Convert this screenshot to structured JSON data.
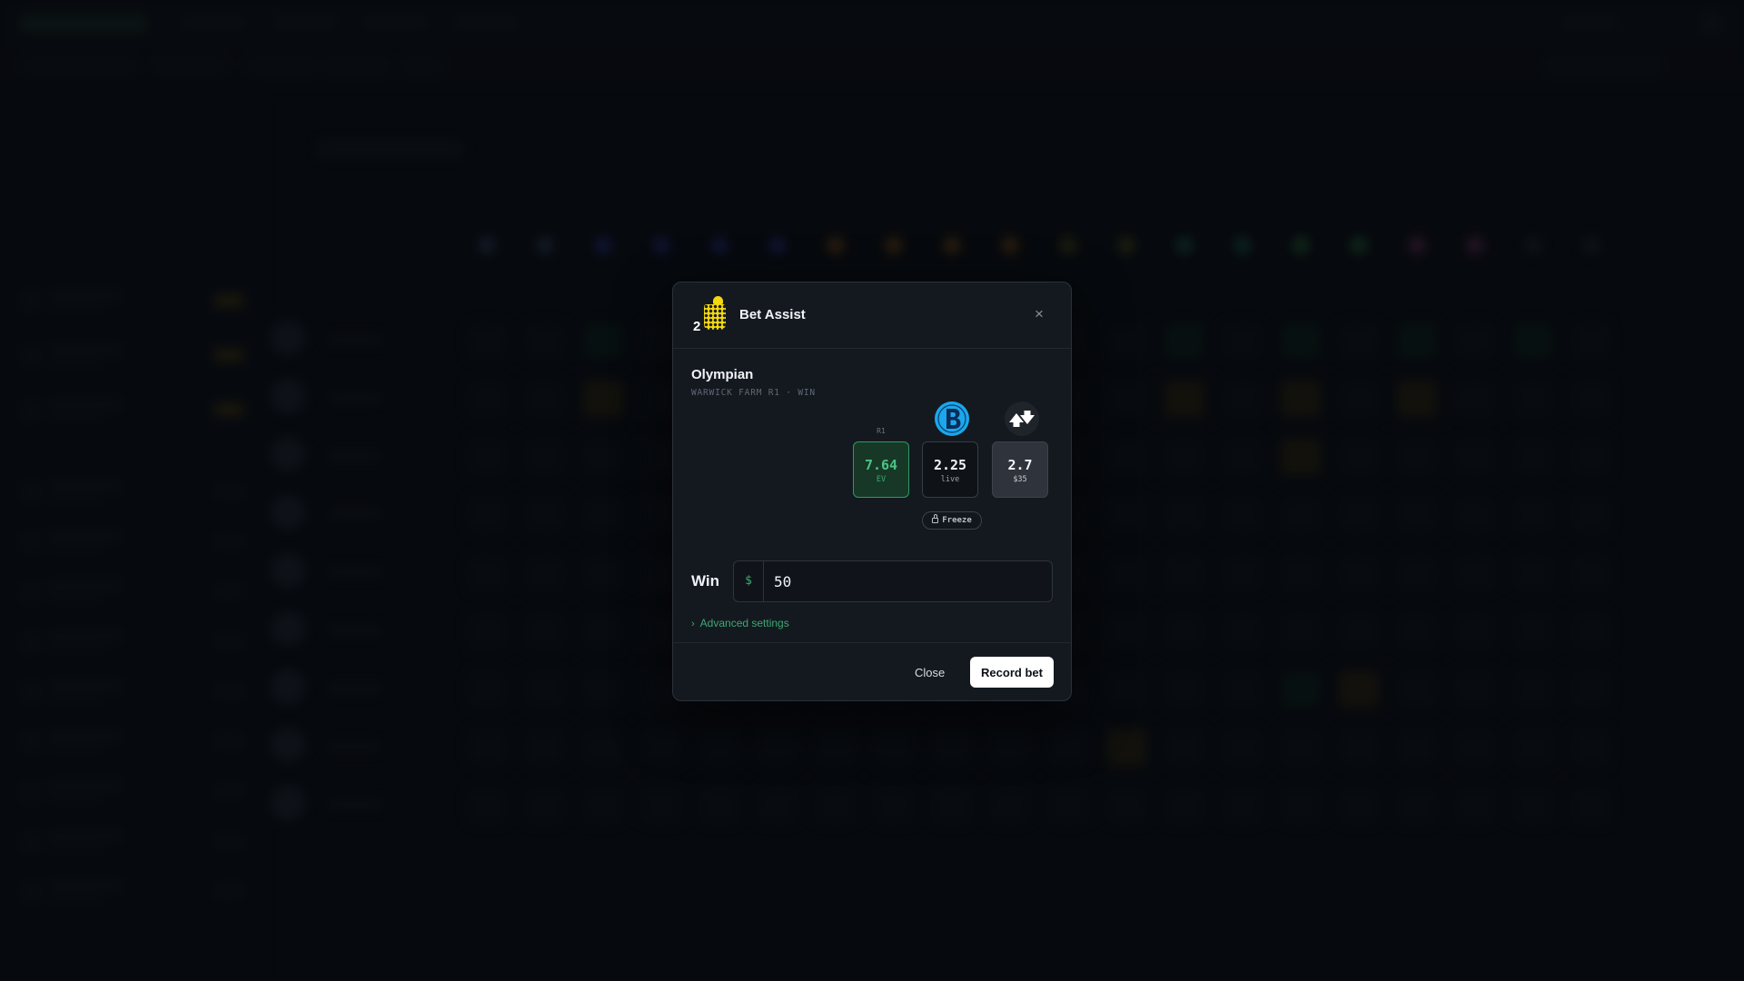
{
  "modal": {
    "title": "Bet Assist",
    "close_icon": "×",
    "saddlecloth": "2",
    "runner_name": "Olympian",
    "runner_meta": "WARWICK FARM R1 · WIN",
    "columns": {
      "model": {
        "label": "R1",
        "value": "7.64",
        "sub": "EV"
      },
      "bookmaker": {
        "icon": "bookmaker-b-icon",
        "value": "2.25",
        "sub": "live"
      },
      "exchange": {
        "icon": "exchange-arrows-icon",
        "value": "2.7",
        "sub": "$35"
      }
    },
    "freeze_label": "Freeze",
    "bet_type": "Win",
    "stake_prefix": "$",
    "stake_value": "50",
    "advanced_label": "Advanced settings",
    "close_button": "Close",
    "record_button": "Record bet"
  },
  "colors": {
    "accent_green": "#3fa870",
    "silk_yellow": "#f2d80f",
    "bookmaker_blue": "#1aa7ec"
  }
}
